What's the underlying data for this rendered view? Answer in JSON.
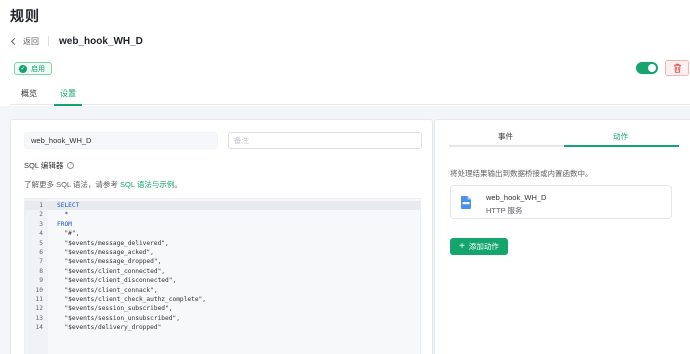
{
  "page": {
    "title": "规则"
  },
  "header": {
    "back_label": "返回",
    "rule_name": "web_hook_WH_D"
  },
  "status": {
    "label": "启用",
    "enabled": true,
    "accent": "#13a56d"
  },
  "tabs": [
    {
      "label": "概览"
    },
    {
      "label": "设置"
    }
  ],
  "form": {
    "name_value": "web_hook_WH_D",
    "note_placeholder": "备注",
    "sql_editor_label": "SQL 编辑器",
    "hint_prefix": "了解更多 SQL 语法，请参考",
    "hint_link": "SQL 语法与示例",
    "hint_suffix": "。"
  },
  "sql_lines": [
    {
      "n": "1",
      "text": "SELECT",
      "kw": true
    },
    {
      "n": "2",
      "text": "  *",
      "kw": false
    },
    {
      "n": "3",
      "text": "FROM",
      "kw": true
    },
    {
      "n": "4",
      "text": "  \"#\",",
      "kw": false
    },
    {
      "n": "5",
      "text": "  \"$events/message_delivered\",",
      "kw": false
    },
    {
      "n": "6",
      "text": "  \"$events/message_acked\",",
      "kw": false
    },
    {
      "n": "7",
      "text": "  \"$events/message_dropped\",",
      "kw": false
    },
    {
      "n": "8",
      "text": "  \"$events/client_connected\",",
      "kw": false
    },
    {
      "n": "9",
      "text": "  \"$events/client_disconnected\",",
      "kw": false
    },
    {
      "n": "10",
      "text": "  \"$events/client_connack\",",
      "kw": false
    },
    {
      "n": "11",
      "text": "  \"$events/client_check_authz_complete\",",
      "kw": false
    },
    {
      "n": "12",
      "text": "  \"$events/session_subscribed\",",
      "kw": false
    },
    {
      "n": "13",
      "text": "  \"$events/session_unsubscribed\",",
      "kw": false
    },
    {
      "n": "14",
      "text": "  \"$events/delivery_dropped\"",
      "kw": false
    }
  ],
  "right_panel": {
    "tabs": [
      {
        "label": "事件"
      },
      {
        "label": "动作"
      }
    ],
    "output_desc": "将处理结果输出到数据桥接或内置函数中。",
    "action": {
      "name": "web_hook_WH_D",
      "type": "HTTP 服务",
      "icon": "http-file-icon"
    },
    "add_action_label": "添加动作"
  }
}
